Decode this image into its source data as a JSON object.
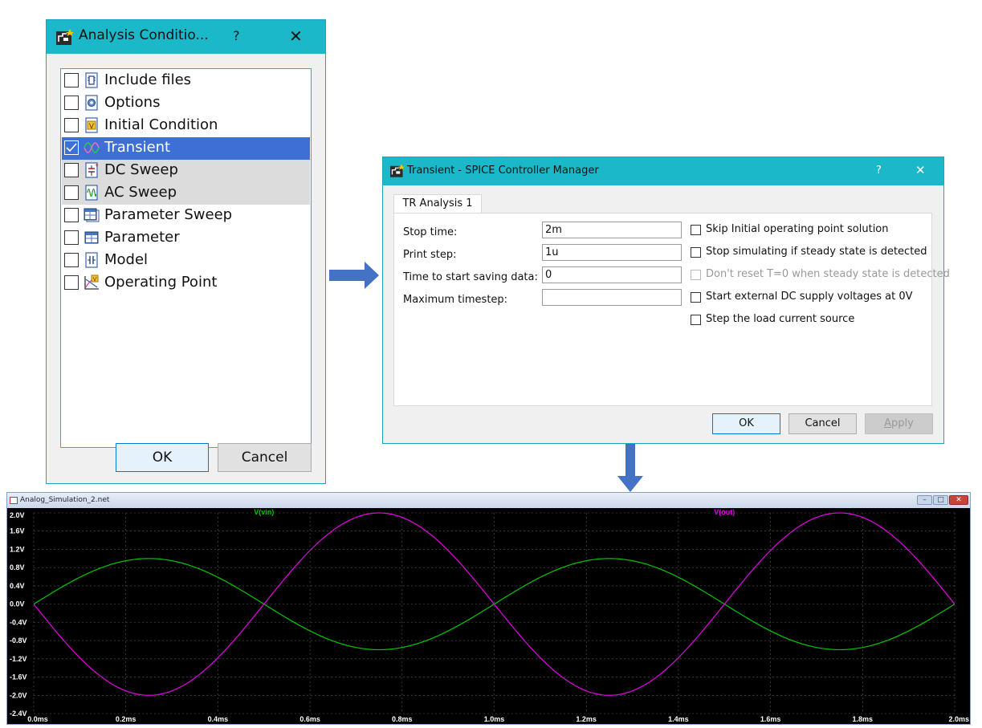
{
  "analysis_dialog": {
    "title": "Analysis Conditio...",
    "help": "?",
    "close": "✕",
    "items": [
      {
        "label": "Include files",
        "checked": false,
        "icon": "include-files-icon"
      },
      {
        "label": "Options",
        "checked": false,
        "icon": "options-gear-icon"
      },
      {
        "label": "Initial Condition",
        "checked": false,
        "icon": "initial-condition-icon"
      },
      {
        "label": "Transient",
        "checked": true,
        "icon": "transient-wave-icon"
      },
      {
        "label": "DC Sweep",
        "checked": false,
        "icon": "dc-sweep-icon"
      },
      {
        "label": "AC Sweep",
        "checked": false,
        "icon": "ac-sweep-icon"
      },
      {
        "label": "Parameter Sweep",
        "checked": false,
        "icon": "parameter-sweep-icon"
      },
      {
        "label": "Parameter",
        "checked": false,
        "icon": "parameter-icon"
      },
      {
        "label": "Model",
        "checked": false,
        "icon": "model-icon"
      },
      {
        "label": "Operating Point",
        "checked": false,
        "icon": "operating-point-icon"
      }
    ],
    "ok_label": "OK",
    "cancel_label": "Cancel"
  },
  "transient_dialog": {
    "title": "Transient - SPICE Controller Manager",
    "help": "?",
    "close": "✕",
    "tab_label": "TR Analysis 1",
    "fields": [
      {
        "label": "Stop time:",
        "value": "2m"
      },
      {
        "label": "Print step:",
        "value": "1u"
      },
      {
        "label": "Time to start saving data:",
        "value": "0"
      },
      {
        "label": "Maximum timestep:",
        "value": ""
      }
    ],
    "options": [
      {
        "label": "Skip Initial operating point solution",
        "checked": false,
        "disabled": false
      },
      {
        "label": "Stop simulating if steady state is detected",
        "checked": false,
        "disabled": false
      },
      {
        "label": "Don't reset T=0 when steady state is detected",
        "checked": false,
        "disabled": true
      },
      {
        "label": "Start external DC supply voltages at 0V",
        "checked": false,
        "disabled": false
      },
      {
        "label": "Step the load current source",
        "checked": false,
        "disabled": false
      }
    ],
    "ok_label": "OK",
    "cancel_label": "Cancel",
    "apply_label": "Apply"
  },
  "waveform_window": {
    "title": "Analog_Simulation_2.net",
    "min_glyph": "–",
    "max_glyph": "□",
    "close_glyph": "✕"
  },
  "colors": {
    "accent_teal": "#1ab8c8",
    "selection_blue": "#3d6fd4",
    "arrow_blue": "#4472c4",
    "vin_green": "#00c800",
    "vout_magenta": "#e800e8"
  },
  "chart_data": {
    "type": "line",
    "x_unit": "ms",
    "xlim": [
      0,
      2.0
    ],
    "ylim": [
      -2.4,
      2.0
    ],
    "x_ticks": [
      "0.0ms",
      "0.2ms",
      "0.4ms",
      "0.6ms",
      "0.8ms",
      "1.0ms",
      "1.2ms",
      "1.4ms",
      "1.6ms",
      "1.8ms",
      "2.0ms"
    ],
    "y_ticks": [
      "2.0V",
      "1.6V",
      "1.2V",
      "0.8V",
      "0.4V",
      "0.0V",
      "-0.4V",
      "-0.8V",
      "-1.2V",
      "-1.6V",
      "-2.0V",
      "-2.4V"
    ],
    "grid": true,
    "series": [
      {
        "name": "V(vin)",
        "color": "#00c800",
        "amplitude": 1.0,
        "frequency_khz": 1,
        "phase": "sine",
        "values": [
          [
            0,
            0
          ],
          [
            0.25,
            1.0
          ],
          [
            0.5,
            0
          ],
          [
            0.75,
            -1.0
          ],
          [
            1.0,
            0
          ],
          [
            1.25,
            1.0
          ],
          [
            1.5,
            0
          ],
          [
            1.75,
            -1.0
          ],
          [
            2.0,
            0
          ]
        ]
      },
      {
        "name": "V(out)",
        "color": "#e800e8",
        "amplitude": 2.0,
        "frequency_khz": 1,
        "phase": "inverted sine",
        "values": [
          [
            0,
            0
          ],
          [
            0.25,
            -2.0
          ],
          [
            0.5,
            0
          ],
          [
            0.75,
            2.0
          ],
          [
            1.0,
            0
          ],
          [
            1.25,
            -2.0
          ],
          [
            1.5,
            0
          ],
          [
            1.75,
            2.0
          ],
          [
            2.0,
            0
          ]
        ]
      }
    ]
  }
}
